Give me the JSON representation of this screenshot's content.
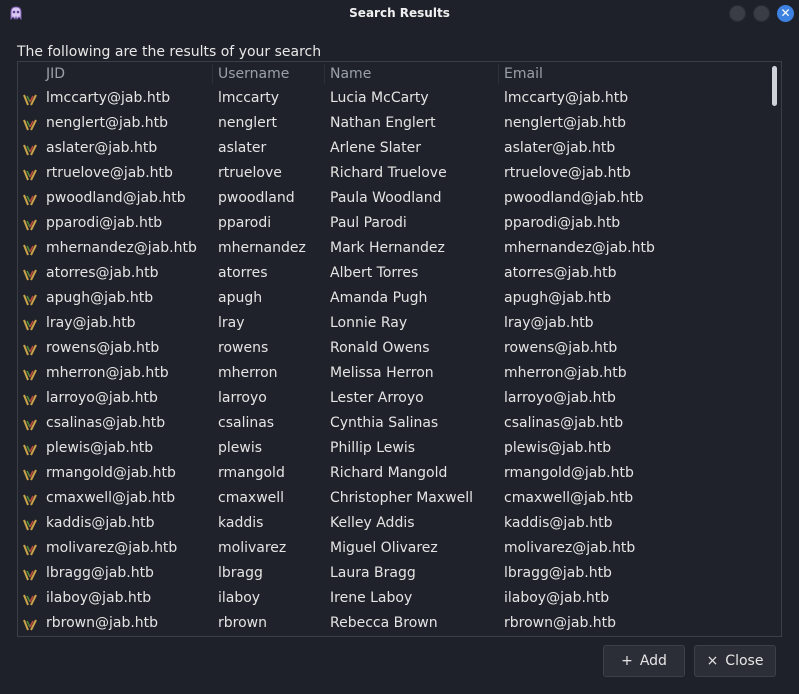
{
  "window": {
    "title": "Search Results",
    "close_glyph": "✕"
  },
  "subtitle": "The following are the results of your search",
  "table": {
    "headers": [
      "JID",
      "Username",
      "Name",
      "Email"
    ],
    "rows": [
      {
        "jid": "lmccarty@jab.htb",
        "username": "lmccarty",
        "name": "Lucia McCarty",
        "email": "lmccarty@jab.htb"
      },
      {
        "jid": "nenglert@jab.htb",
        "username": "nenglert",
        "name": "Nathan Englert",
        "email": "nenglert@jab.htb"
      },
      {
        "jid": "aslater@jab.htb",
        "username": "aslater",
        "name": "Arlene Slater",
        "email": "aslater@jab.htb"
      },
      {
        "jid": "rtruelove@jab.htb",
        "username": "rtruelove",
        "name": "Richard Truelove",
        "email": "rtruelove@jab.htb"
      },
      {
        "jid": "pwoodland@jab.htb",
        "username": "pwoodland",
        "name": "Paula Woodland",
        "email": "pwoodland@jab.htb"
      },
      {
        "jid": "pparodi@jab.htb",
        "username": "pparodi",
        "name": "Paul Parodi",
        "email": "pparodi@jab.htb"
      },
      {
        "jid": "mhernandez@jab.htb",
        "username": "mhernandez",
        "name": "Mark Hernandez",
        "email": "mhernandez@jab.htb"
      },
      {
        "jid": "atorres@jab.htb",
        "username": "atorres",
        "name": "Albert Torres",
        "email": "atorres@jab.htb"
      },
      {
        "jid": "apugh@jab.htb",
        "username": "apugh",
        "name": "Amanda Pugh",
        "email": "apugh@jab.htb"
      },
      {
        "jid": "lray@jab.htb",
        "username": "lray",
        "name": "Lonnie Ray",
        "email": "lray@jab.htb"
      },
      {
        "jid": "rowens@jab.htb",
        "username": "rowens",
        "name": "Ronald Owens",
        "email": "rowens@jab.htb"
      },
      {
        "jid": "mherron@jab.htb",
        "username": "mherron",
        "name": "Melissa Herron",
        "email": "mherron@jab.htb"
      },
      {
        "jid": "larroyo@jab.htb",
        "username": "larroyo",
        "name": "Lester Arroyo",
        "email": "larroyo@jab.htb"
      },
      {
        "jid": "csalinas@jab.htb",
        "username": "csalinas",
        "name": "Cynthia Salinas",
        "email": "csalinas@jab.htb"
      },
      {
        "jid": "plewis@jab.htb",
        "username": "plewis",
        "name": "Phillip Lewis",
        "email": "plewis@jab.htb"
      },
      {
        "jid": "rmangold@jab.htb",
        "username": "rmangold",
        "name": "Richard Mangold",
        "email": "rmangold@jab.htb"
      },
      {
        "jid": "cmaxwell@jab.htb",
        "username": "cmaxwell",
        "name": "Christopher Maxwell",
        "email": "cmaxwell@jab.htb"
      },
      {
        "jid": "kaddis@jab.htb",
        "username": "kaddis",
        "name": "Kelley Addis",
        "email": "kaddis@jab.htb"
      },
      {
        "jid": "molivarez@jab.htb",
        "username": "molivarez",
        "name": "Miguel Olivarez",
        "email": "molivarez@jab.htb"
      },
      {
        "jid": "lbragg@jab.htb",
        "username": "lbragg",
        "name": "Laura Bragg",
        "email": "lbragg@jab.htb"
      },
      {
        "jid": "ilaboy@jab.htb",
        "username": "ilaboy",
        "name": "Irene Laboy",
        "email": "ilaboy@jab.htb"
      },
      {
        "jid": "rbrown@jab.htb",
        "username": "rbrown",
        "name": "Rebecca Brown",
        "email": "rbrown@jab.htb"
      }
    ]
  },
  "buttons": {
    "add_glyph": "+",
    "add_label": "Add",
    "close_glyph": "×",
    "close_label": "Close"
  },
  "icons": {
    "app": "app-logo-icon",
    "row": "user-contact-icon"
  },
  "colors": {
    "background": "#1e2129",
    "accent": "#3d82e0",
    "header_text": "#9aa0ab"
  }
}
